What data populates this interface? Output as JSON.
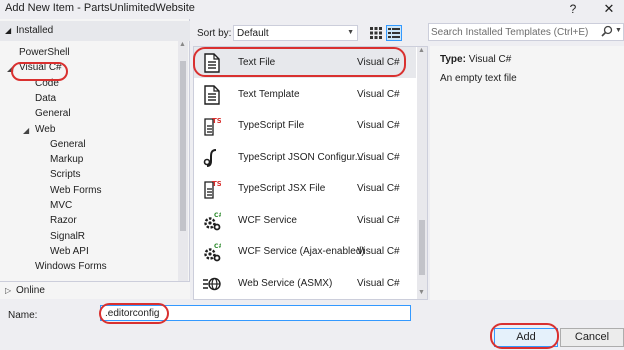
{
  "window": {
    "title": "Add New Item - PartsUnlimitedWebsite",
    "help_glyph": "?",
    "close_glyph": "✕"
  },
  "left_pane": {
    "installed_label": "Installed",
    "tree": [
      {
        "label": "PowerShell",
        "level": 1
      },
      {
        "label": "Visual C#",
        "level": 1,
        "expanded": true
      },
      {
        "label": "Code",
        "level": 2
      },
      {
        "label": "Data",
        "level": 2
      },
      {
        "label": "General",
        "level": 2
      },
      {
        "label": "Web",
        "level": 2,
        "expanded": true
      },
      {
        "label": "General",
        "level": 3
      },
      {
        "label": "Markup",
        "level": 3
      },
      {
        "label": "Scripts",
        "level": 3
      },
      {
        "label": "Web Forms",
        "level": 3
      },
      {
        "label": "MVC",
        "level": 3
      },
      {
        "label": "Razor",
        "level": 3
      },
      {
        "label": "SignalR",
        "level": 3
      },
      {
        "label": "Web API",
        "level": 3
      },
      {
        "label": "Windows Forms",
        "level": 2
      }
    ],
    "online_label": "Online"
  },
  "sortbar": {
    "sort_label": "Sort by:",
    "sort_value": "Default"
  },
  "templates": [
    {
      "name": "Text File",
      "lang": "Visual C#",
      "icon": "text-file-icon",
      "selected": true
    },
    {
      "name": "Text Template",
      "lang": "Visual C#",
      "icon": "text-template-icon"
    },
    {
      "name": "TypeScript File",
      "lang": "Visual C#",
      "icon": "typescript-file-icon"
    },
    {
      "name": "TypeScript JSON Configur...",
      "lang": "Visual C#",
      "icon": "typescript-json-config-icon"
    },
    {
      "name": "TypeScript JSX File",
      "lang": "Visual C#",
      "icon": "typescript-jsx-file-icon"
    },
    {
      "name": "WCF Service",
      "lang": "Visual C#",
      "icon": "wcf-service-icon"
    },
    {
      "name": "WCF Service (Ajax-enabled)",
      "lang": "Visual C#",
      "icon": "wcf-ajax-service-icon"
    },
    {
      "name": "Web Service (ASMX)",
      "lang": "Visual C#",
      "icon": "web-service-icon"
    }
  ],
  "search": {
    "placeholder": "Search Installed Templates (Ctrl+E)"
  },
  "details": {
    "type_label": "Type:",
    "type_value": "Visual C#",
    "description": "An empty text file"
  },
  "name_field": {
    "label": "Name:",
    "value": ".editorconfig"
  },
  "buttons": {
    "add": "Add",
    "cancel": "Cancel"
  },
  "colors": {
    "callout": "#d9302f",
    "selection": "#e7e8ec",
    "focus": "#3399ff"
  }
}
